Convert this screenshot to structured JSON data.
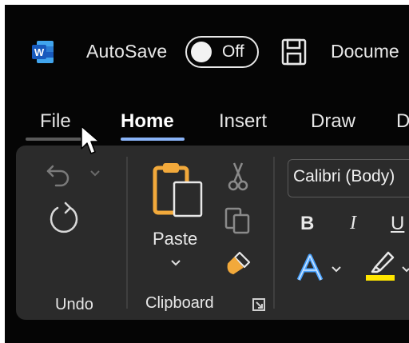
{
  "titlebar": {
    "app_icon": "word-logo-icon",
    "app_letter": "W",
    "autosave_label": "AutoSave",
    "autosave_state": "Off",
    "save_icon": "save-floppy-icon",
    "document_title": "Docume"
  },
  "tabs": [
    {
      "label": "File",
      "active": false
    },
    {
      "label": "Home",
      "active": true
    },
    {
      "label": "Insert",
      "active": false
    },
    {
      "label": "Draw",
      "active": false
    },
    {
      "label": "D",
      "active": false
    }
  ],
  "ribbon": {
    "undo_group": {
      "label": "Undo",
      "undo_icon": "undo-arrow-icon",
      "redo_icon": "redo-arrow-icon"
    },
    "clipboard_group": {
      "label": "Clipboard",
      "paste_label": "Paste",
      "paste_icon": "paste-clipboard-icon",
      "cut_icon": "scissors-icon",
      "copy_icon": "copy-icon",
      "format_painter_icon": "format-painter-brush-icon",
      "launcher_icon": "dialog-launcher-icon"
    },
    "font_group": {
      "font_name": "Calibri (Body)",
      "bold_label": "B",
      "italic_label": "I",
      "underline_label": "U",
      "text_effects_icon": "text-effects-a-icon",
      "highlighter_icon": "highlighter-icon",
      "highlight_color": "#ffe600"
    }
  },
  "colors": {
    "background": "#050505",
    "ribbon": "#2b2b2b",
    "word_blue": "#185abd",
    "active_tab_underline": "#8ab4f8",
    "paste_orange": "#f2a93b",
    "text_effect_blue": "#4aa3ff"
  },
  "pointer": "mouse-pointer-icon"
}
